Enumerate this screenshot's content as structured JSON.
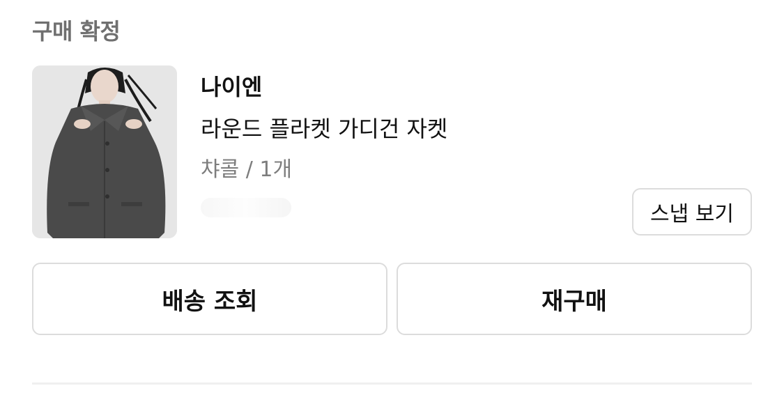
{
  "order": {
    "status": "구매 확정",
    "product": {
      "brand": "나이엔",
      "name": "라운드 플라켓 가디건 자켓",
      "option": "챠콜 / 1개",
      "image_icon": "product-photo"
    },
    "snap_label": "스냅 보기",
    "actions": {
      "track_label": "배송 조회",
      "rebuy_label": "재구매"
    }
  },
  "colors": {
    "status_text": "#6f6f6f",
    "option_text": "#7d7d7d",
    "button_border": "#dcdcdc",
    "divider": "#f0f0f0"
  }
}
